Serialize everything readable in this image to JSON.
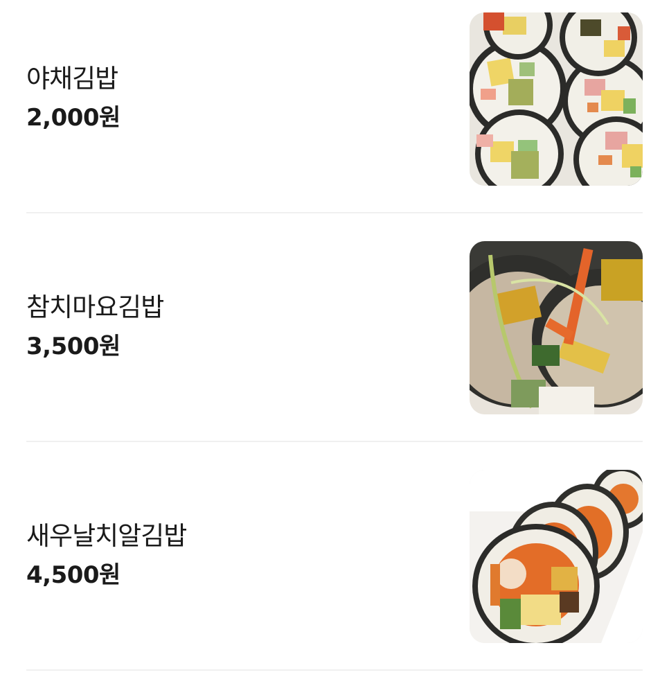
{
  "menu": {
    "items": [
      {
        "name": "야채김밥",
        "price": "2,000원",
        "image": "kimbap-vegetable-photo"
      },
      {
        "name": "참치마요김밥",
        "price": "3,500원",
        "image": "kimbap-tuna-mayo-photo"
      },
      {
        "name": "새우날치알김밥",
        "price": "4,500원",
        "image": "kimbap-shrimp-roe-photo"
      }
    ]
  },
  "colors": {
    "text": "#1a1a1a",
    "divider": "#f0f0f0",
    "background": "#ffffff"
  }
}
